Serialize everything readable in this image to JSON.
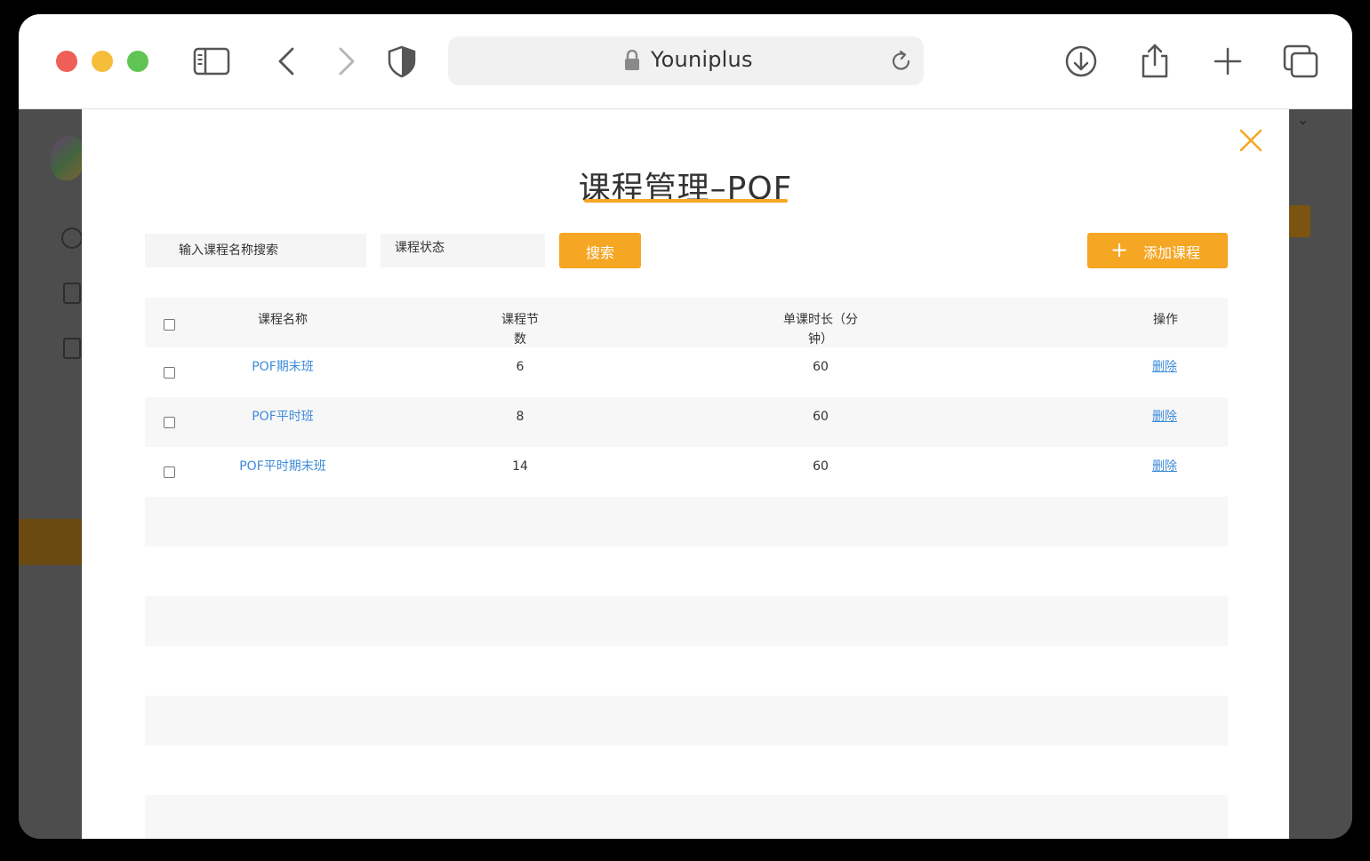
{
  "browser": {
    "address_text": "Youniplus"
  },
  "modal": {
    "title": "课程管理–POF",
    "search_placeholder": "输入课程名称搜索",
    "status_label": "课程状态",
    "search_button": "搜索",
    "add_button_plus": "+",
    "add_button_label": "添加课程",
    "accent_color": "#f5a623",
    "link_color": "#3d8bd9"
  },
  "table": {
    "headers": {
      "name": "课程名称",
      "lessons": "课程节数",
      "duration": "单课时长（分钟）",
      "operation": "操作"
    },
    "rows": [
      {
        "name": "POF期末班",
        "lessons": "6",
        "duration": "60",
        "action": "删除"
      },
      {
        "name": "POF平时班",
        "lessons": "8",
        "duration": "60",
        "action": "删除"
      },
      {
        "name": "POF平时期末班",
        "lessons": "14",
        "duration": "60",
        "action": "删除"
      }
    ]
  }
}
